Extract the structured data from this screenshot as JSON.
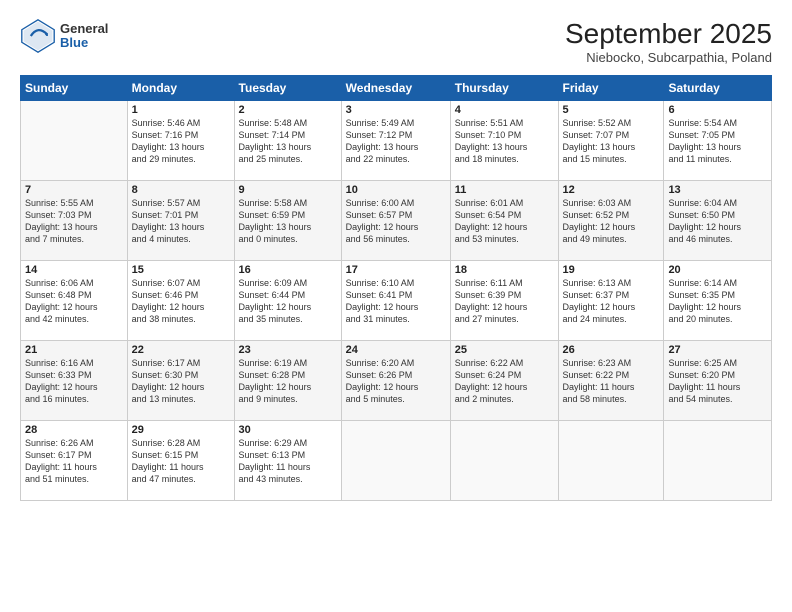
{
  "header": {
    "logo_general": "General",
    "logo_blue": "Blue",
    "month": "September 2025",
    "location": "Niebocko, Subcarpathia, Poland"
  },
  "days_of_week": [
    "Sunday",
    "Monday",
    "Tuesday",
    "Wednesday",
    "Thursday",
    "Friday",
    "Saturday"
  ],
  "weeks": [
    [
      {
        "day": "",
        "info": ""
      },
      {
        "day": "1",
        "info": "Sunrise: 5:46 AM\nSunset: 7:16 PM\nDaylight: 13 hours\nand 29 minutes."
      },
      {
        "day": "2",
        "info": "Sunrise: 5:48 AM\nSunset: 7:14 PM\nDaylight: 13 hours\nand 25 minutes."
      },
      {
        "day": "3",
        "info": "Sunrise: 5:49 AM\nSunset: 7:12 PM\nDaylight: 13 hours\nand 22 minutes."
      },
      {
        "day": "4",
        "info": "Sunrise: 5:51 AM\nSunset: 7:10 PM\nDaylight: 13 hours\nand 18 minutes."
      },
      {
        "day": "5",
        "info": "Sunrise: 5:52 AM\nSunset: 7:07 PM\nDaylight: 13 hours\nand 15 minutes."
      },
      {
        "day": "6",
        "info": "Sunrise: 5:54 AM\nSunset: 7:05 PM\nDaylight: 13 hours\nand 11 minutes."
      }
    ],
    [
      {
        "day": "7",
        "info": "Sunrise: 5:55 AM\nSunset: 7:03 PM\nDaylight: 13 hours\nand 7 minutes."
      },
      {
        "day": "8",
        "info": "Sunrise: 5:57 AM\nSunset: 7:01 PM\nDaylight: 13 hours\nand 4 minutes."
      },
      {
        "day": "9",
        "info": "Sunrise: 5:58 AM\nSunset: 6:59 PM\nDaylight: 13 hours\nand 0 minutes."
      },
      {
        "day": "10",
        "info": "Sunrise: 6:00 AM\nSunset: 6:57 PM\nDaylight: 12 hours\nand 56 minutes."
      },
      {
        "day": "11",
        "info": "Sunrise: 6:01 AM\nSunset: 6:54 PM\nDaylight: 12 hours\nand 53 minutes."
      },
      {
        "day": "12",
        "info": "Sunrise: 6:03 AM\nSunset: 6:52 PM\nDaylight: 12 hours\nand 49 minutes."
      },
      {
        "day": "13",
        "info": "Sunrise: 6:04 AM\nSunset: 6:50 PM\nDaylight: 12 hours\nand 46 minutes."
      }
    ],
    [
      {
        "day": "14",
        "info": "Sunrise: 6:06 AM\nSunset: 6:48 PM\nDaylight: 12 hours\nand 42 minutes."
      },
      {
        "day": "15",
        "info": "Sunrise: 6:07 AM\nSunset: 6:46 PM\nDaylight: 12 hours\nand 38 minutes."
      },
      {
        "day": "16",
        "info": "Sunrise: 6:09 AM\nSunset: 6:44 PM\nDaylight: 12 hours\nand 35 minutes."
      },
      {
        "day": "17",
        "info": "Sunrise: 6:10 AM\nSunset: 6:41 PM\nDaylight: 12 hours\nand 31 minutes."
      },
      {
        "day": "18",
        "info": "Sunrise: 6:11 AM\nSunset: 6:39 PM\nDaylight: 12 hours\nand 27 minutes."
      },
      {
        "day": "19",
        "info": "Sunrise: 6:13 AM\nSunset: 6:37 PM\nDaylight: 12 hours\nand 24 minutes."
      },
      {
        "day": "20",
        "info": "Sunrise: 6:14 AM\nSunset: 6:35 PM\nDaylight: 12 hours\nand 20 minutes."
      }
    ],
    [
      {
        "day": "21",
        "info": "Sunrise: 6:16 AM\nSunset: 6:33 PM\nDaylight: 12 hours\nand 16 minutes."
      },
      {
        "day": "22",
        "info": "Sunrise: 6:17 AM\nSunset: 6:30 PM\nDaylight: 12 hours\nand 13 minutes."
      },
      {
        "day": "23",
        "info": "Sunrise: 6:19 AM\nSunset: 6:28 PM\nDaylight: 12 hours\nand 9 minutes."
      },
      {
        "day": "24",
        "info": "Sunrise: 6:20 AM\nSunset: 6:26 PM\nDaylight: 12 hours\nand 5 minutes."
      },
      {
        "day": "25",
        "info": "Sunrise: 6:22 AM\nSunset: 6:24 PM\nDaylight: 12 hours\nand 2 minutes."
      },
      {
        "day": "26",
        "info": "Sunrise: 6:23 AM\nSunset: 6:22 PM\nDaylight: 11 hours\nand 58 minutes."
      },
      {
        "day": "27",
        "info": "Sunrise: 6:25 AM\nSunset: 6:20 PM\nDaylight: 11 hours\nand 54 minutes."
      }
    ],
    [
      {
        "day": "28",
        "info": "Sunrise: 6:26 AM\nSunset: 6:17 PM\nDaylight: 11 hours\nand 51 minutes."
      },
      {
        "day": "29",
        "info": "Sunrise: 6:28 AM\nSunset: 6:15 PM\nDaylight: 11 hours\nand 47 minutes."
      },
      {
        "day": "30",
        "info": "Sunrise: 6:29 AM\nSunset: 6:13 PM\nDaylight: 11 hours\nand 43 minutes."
      },
      {
        "day": "",
        "info": ""
      },
      {
        "day": "",
        "info": ""
      },
      {
        "day": "",
        "info": ""
      },
      {
        "day": "",
        "info": ""
      }
    ]
  ]
}
